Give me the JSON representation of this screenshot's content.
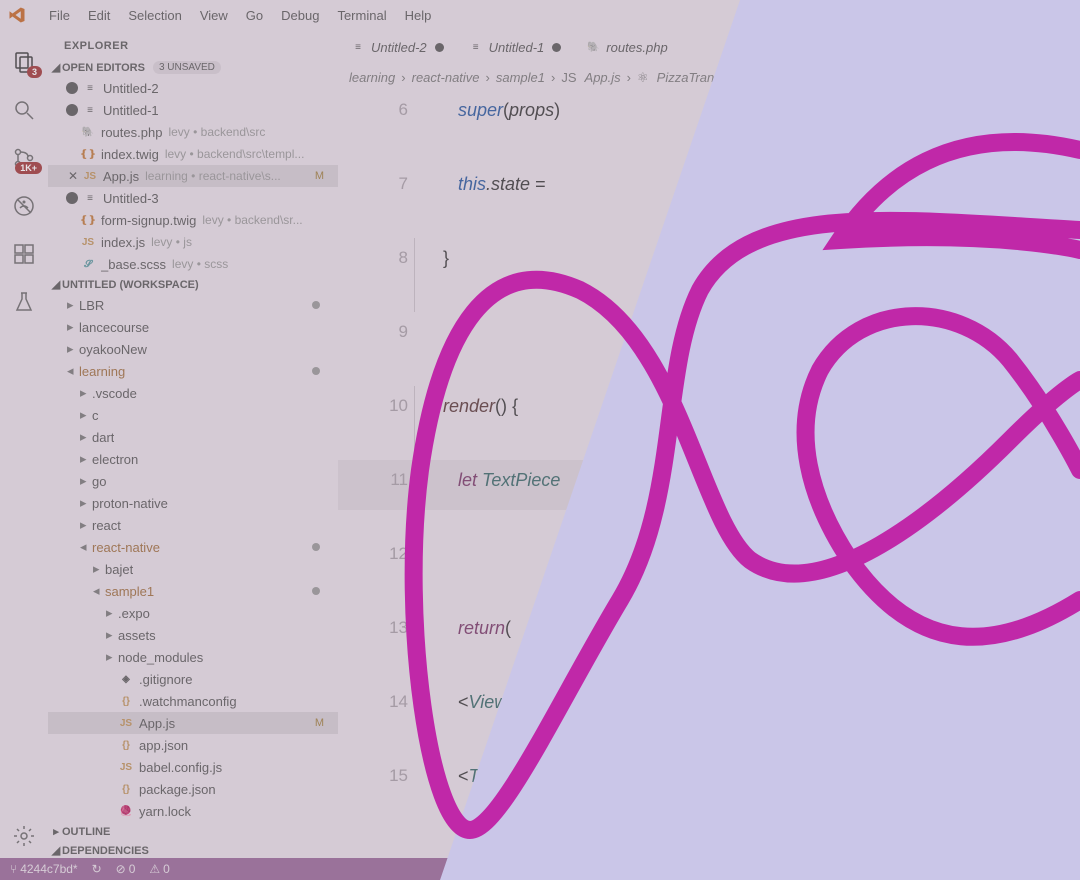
{
  "menu": [
    "File",
    "Edit",
    "Selection",
    "View",
    "Go",
    "Debug",
    "Terminal",
    "Help"
  ],
  "activity": {
    "badge1": "3",
    "badge2": "1K+"
  },
  "sidebar": {
    "title": "EXPLORER",
    "openEditors": {
      "label": "OPEN EDITORS",
      "unsaved": "3 UNSAVED",
      "items": [
        {
          "icon": "≡",
          "cls": "",
          "label": "Untitled-2",
          "dot": true
        },
        {
          "icon": "≡",
          "cls": "",
          "label": "Untitled-1",
          "dot": true
        },
        {
          "icon": "🐘",
          "cls": "php",
          "label": "routes.php",
          "path": "levy • backend\\src"
        },
        {
          "icon": "❴❵",
          "cls": "twig",
          "label": "index.twig",
          "path": "levy • backend\\src\\templ..."
        },
        {
          "icon": "JS",
          "cls": "js",
          "label": "App.js",
          "path": "learning • react-native\\s...",
          "mod": "M",
          "selected": true,
          "close": true
        },
        {
          "icon": "≡",
          "cls": "",
          "label": "Untitled-3",
          "dot": true
        },
        {
          "icon": "❴❵",
          "cls": "twig",
          "label": "form-signup.twig",
          "path": "levy • backend\\sr..."
        },
        {
          "icon": "JS",
          "cls": "js",
          "label": "index.js",
          "path": "levy • js"
        },
        {
          "icon": "𝓢",
          "cls": "scss",
          "label": "_base.scss",
          "path": "levy • scss"
        }
      ]
    },
    "workspace": {
      "label": "UNTITLED (WORKSPACE)",
      "tree": [
        {
          "d": 1,
          "chev": "▸",
          "label": "LBR",
          "dotR": true
        },
        {
          "d": 1,
          "chev": "▸",
          "label": "lancecourse"
        },
        {
          "d": 1,
          "chev": "▸",
          "label": "oyakooNew"
        },
        {
          "d": 1,
          "chev": "◂",
          "label": "learning",
          "dotR": true,
          "active": true
        },
        {
          "d": 2,
          "chev": "▸",
          "label": ".vscode"
        },
        {
          "d": 2,
          "chev": "▸",
          "label": "c"
        },
        {
          "d": 2,
          "chev": "▸",
          "label": "dart"
        },
        {
          "d": 2,
          "chev": "▸",
          "label": "electron"
        },
        {
          "d": 2,
          "chev": "▸",
          "label": "go"
        },
        {
          "d": 2,
          "chev": "▸",
          "label": "proton-native"
        },
        {
          "d": 2,
          "chev": "▸",
          "label": "react"
        },
        {
          "d": 2,
          "chev": "◂",
          "label": "react-native",
          "dotR": true,
          "active": true
        },
        {
          "d": 3,
          "chev": "▸",
          "label": "bajet"
        },
        {
          "d": 3,
          "chev": "◂",
          "label": "sample1",
          "dotR": true,
          "active": true
        },
        {
          "d": 4,
          "chev": "▸",
          "label": ".expo"
        },
        {
          "d": 4,
          "chev": "▸",
          "label": "assets"
        },
        {
          "d": 4,
          "chev": "▸",
          "label": "node_modules"
        },
        {
          "d": 4,
          "icon": "◈",
          "label": ".gitignore"
        },
        {
          "d": 4,
          "icon": "{}",
          "cls": "json",
          "label": ".watchmanconfig"
        },
        {
          "d": 4,
          "icon": "JS",
          "cls": "js",
          "label": "App.js",
          "mod": "M",
          "selected": true
        },
        {
          "d": 4,
          "icon": "{}",
          "cls": "json",
          "label": "app.json"
        },
        {
          "d": 4,
          "icon": "JS",
          "cls": "js",
          "label": "babel.config.js"
        },
        {
          "d": 4,
          "icon": "{}",
          "cls": "json",
          "label": "package.json"
        },
        {
          "d": 4,
          "icon": "🧶",
          "label": "yarn.lock"
        }
      ]
    },
    "outline": "OUTLINE",
    "dependencies": "DEPENDENCIES"
  },
  "tabs": [
    {
      "icon": "≡",
      "cls": "",
      "label": "Untitled-2",
      "dot": true
    },
    {
      "icon": "≡",
      "cls": "",
      "label": "Untitled-1",
      "dot": true
    },
    {
      "icon": "🐘",
      "cls": "php",
      "label": "routes.php"
    }
  ],
  "breadcrumb": [
    "learning",
    "react-native",
    "sample1",
    "App.js",
    "PizzaTranslat"
  ],
  "bc_icons": [
    "",
    "",
    "",
    "JS",
    "⚛"
  ],
  "gutter": [
    "6",
    "7",
    "8",
    "9",
    "",
    "",
    "12",
    "13",
    "14",
    "15"
  ],
  "gutter_extra": [
    "10",
    "11"
  ],
  "code": [
    {
      "html": "      <span class='k-super'>super</span><span class='k-paren'>(</span><span class='k-prop'>props</span><span class='k-paren'>)</span>"
    },
    {
      "html": "      <span class='k-this'>this</span><span class='k-prop'>.state </span><span class='k-brace'>=</span>"
    },
    {
      "html": "   <span class='k-brace'>}</span>",
      "br": true
    },
    {
      "html": ""
    },
    {
      "html": "   <span class='k-func'>render</span><span class='k-paren'>()</span> <span class='k-brace'>{</span>",
      "br": true
    },
    {
      "html": "      <span class='k-kw'>let</span> <span class='k-var'>TextPiece</span>",
      "hl": true
    },
    {
      "html": ""
    },
    {
      "html": "      <span class='k-kw'>return</span><span class='k-paren'>(</span>"
    },
    {
      "html": "      <span class='k-brace'>&lt;</span><span class='k-tag'>View</span> <span class='k-attr'>style</span>"
    },
    {
      "html": "      <span class='k-brace'>&lt;</span><span class='k-tag'>TextInpu</span>"
    }
  ],
  "status": {
    "branch": "4244c7bd*",
    "sync": "↻",
    "err": "0",
    "warn": "0"
  }
}
